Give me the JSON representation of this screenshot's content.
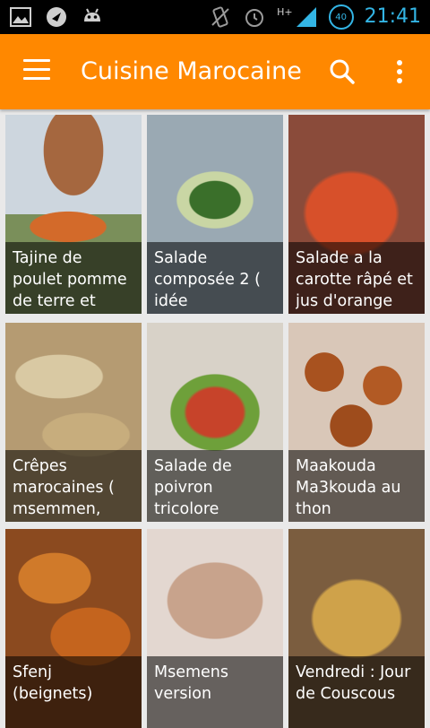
{
  "status_bar": {
    "time": "21:41",
    "battery": "40",
    "network": "H+",
    "icons_left": [
      "image-icon",
      "messenger-icon",
      "android-icon"
    ],
    "icons_right": [
      "vibrate-icon",
      "alarm-icon",
      "signal-icon",
      "battery-icon"
    ]
  },
  "action_bar": {
    "title": "Cuisine Marocaine",
    "menu_icon": "hamburger-menu-icon",
    "search_icon": "search-icon",
    "overflow_icon": "more-vert-icon",
    "background": "#ff8800"
  },
  "recipes": [
    {
      "title": "Tajine de poulet pomme de terre et"
    },
    {
      "title": "Salade composée 2 ( idée"
    },
    {
      "title": "Salade a la carotte râpé et jus d'orange"
    },
    {
      "title": "Crêpes marocaines ( msemmen,"
    },
    {
      "title": "Salade de poivron tricolore"
    },
    {
      "title": "Maakouda Ma3kouda au thon"
    },
    {
      "title": "Sfenj (beignets)"
    },
    {
      "title": "Msemens version"
    },
    {
      "title": "Vendredi : Jour de Couscous"
    }
  ]
}
